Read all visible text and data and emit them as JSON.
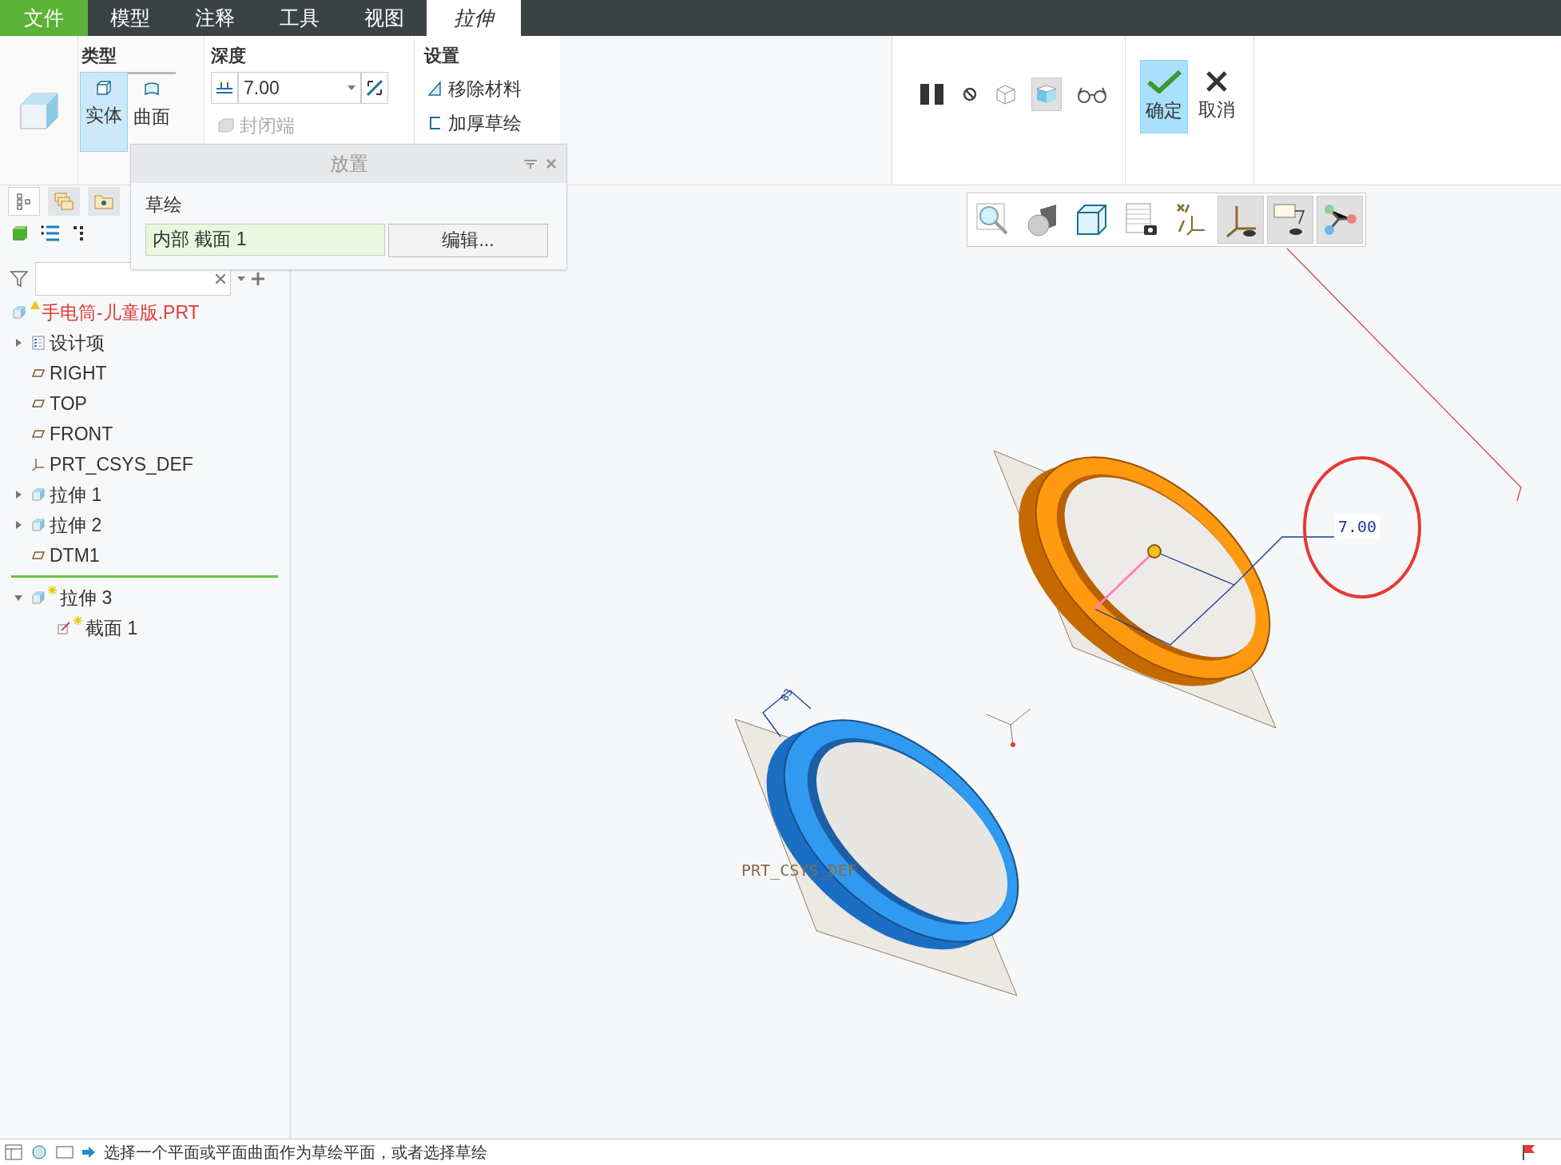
{
  "menu_tabs": [
    {
      "label": "文件",
      "kind": "file",
      "selected": false
    },
    {
      "label": "模型",
      "kind": "tab",
      "selected": false
    },
    {
      "label": "注释",
      "kind": "tab",
      "selected": false
    },
    {
      "label": "工具",
      "kind": "tab",
      "selected": false
    },
    {
      "label": "视图",
      "kind": "tab",
      "selected": false
    },
    {
      "label": "拉伸",
      "kind": "context",
      "selected": true
    }
  ],
  "ribbon": {
    "type_group": {
      "title": "类型",
      "options": [
        {
          "label": "实体",
          "kind": "solid",
          "selected": true
        },
        {
          "label": "曲面",
          "kind": "surface",
          "selected": false
        }
      ]
    },
    "depth_group": {
      "title": "深度",
      "value": "7.00",
      "cap_ends": {
        "label": "封闭端",
        "disabled": true
      }
    },
    "settings_group": {
      "title": "设置",
      "items": [
        {
          "label": "移除材料",
          "kind": "remove"
        },
        {
          "label": "加厚草绘",
          "kind": "thicken"
        }
      ]
    },
    "tools": [
      {
        "kind": "pause",
        "selected": false
      },
      {
        "kind": "no-preview",
        "selected": false
      },
      {
        "kind": "wire-preview",
        "selected": false
      },
      {
        "kind": "verify",
        "selected": true
      },
      {
        "kind": "glasses",
        "selected": false
      }
    ],
    "ok": {
      "label": "确定",
      "selected": true
    },
    "cancel": {
      "label": "取消"
    }
  },
  "placement_panel": {
    "title": "放置",
    "label": "草绘",
    "value": "内部 截面 1",
    "button": "编辑..."
  },
  "model_tree": {
    "tabs": [
      {
        "kind": "tree",
        "selected": true
      },
      {
        "kind": "layers",
        "selected": false
      },
      {
        "kind": "folder",
        "selected": false
      }
    ],
    "root": {
      "label": "手电筒-儿童版.PRT",
      "kind": "part",
      "warning": true,
      "children": [
        {
          "label": "设计项",
          "kind": "list",
          "expanded": false,
          "new": false
        },
        {
          "label": "RIGHT",
          "kind": "plane",
          "new": false
        },
        {
          "label": "TOP",
          "kind": "plane",
          "new": false
        },
        {
          "label": "FRONT",
          "kind": "plane",
          "new": false
        },
        {
          "label": "PRT_CSYS_DEF",
          "kind": "csys",
          "new": false
        },
        {
          "label": "拉伸 1",
          "kind": "extrude",
          "expanded": false,
          "new": false
        },
        {
          "label": "拉伸 2",
          "kind": "extrude",
          "expanded": false,
          "new": false
        },
        {
          "label": "DTM1",
          "kind": "plane",
          "new": false,
          "insert_after": true
        },
        {
          "label": "拉伸 3",
          "kind": "extrude",
          "expanded": true,
          "new": true,
          "children": [
            {
              "label": "截面 1",
              "kind": "sketch",
              "new": true
            }
          ]
        }
      ]
    }
  },
  "view_toolbar": [
    {
      "kind": "zoom",
      "selected": false
    },
    {
      "kind": "shading",
      "selected": false
    },
    {
      "kind": "view-cube",
      "selected": false
    },
    {
      "kind": "saved-views",
      "selected": false
    },
    {
      "kind": "datum",
      "selected": false
    },
    {
      "kind": "csys-display",
      "selected": true
    },
    {
      "kind": "annotation-display",
      "selected": true
    },
    {
      "kind": "spin-center",
      "selected": true
    }
  ],
  "viewport": {
    "dimension": "7.00",
    "side_dimension": "83",
    "csys_label": "PRT_CSYS_DEF"
  },
  "status_bar": {
    "message": "选择一个平面或平面曲面作为草绘平面，或者选择草绘"
  }
}
